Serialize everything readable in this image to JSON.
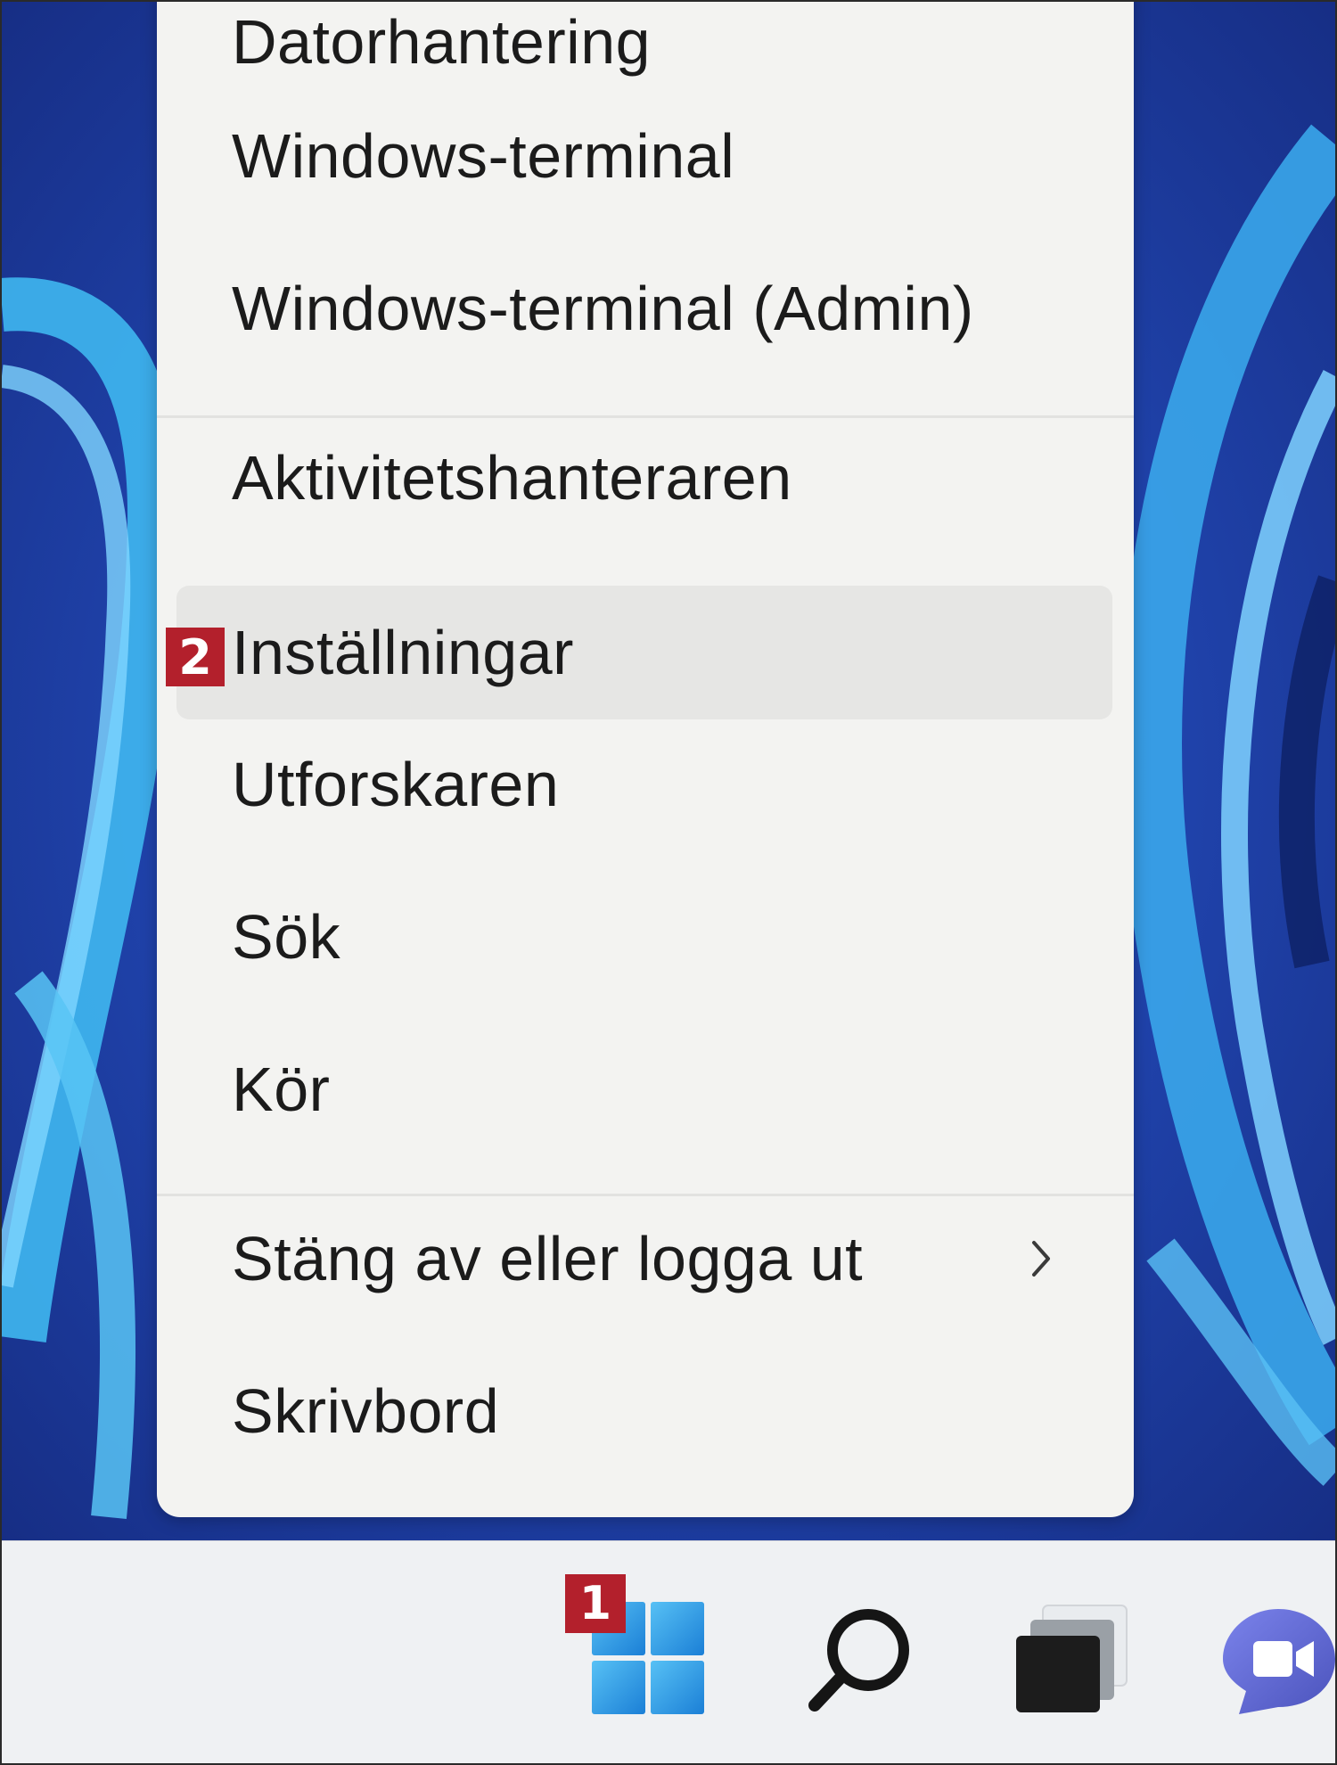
{
  "context_menu": {
    "items": [
      {
        "label": "Datorhantering"
      },
      {
        "label": "Windows-terminal"
      },
      {
        "label": "Windows-terminal (Admin)"
      },
      {
        "label": "Aktivitetshanteraren"
      },
      {
        "label": "Inställningar"
      },
      {
        "label": "Utforskaren"
      },
      {
        "label": "Sök"
      },
      {
        "label": "Kör"
      },
      {
        "label": "Stäng av eller logga ut"
      },
      {
        "label": "Skrivbord"
      }
    ]
  },
  "annotations": {
    "start_marker": "1",
    "settings_marker": "2"
  },
  "taskbar": {
    "icons": [
      "windows-start-icon",
      "search-icon",
      "task-view-icon",
      "teams-chat-icon"
    ]
  },
  "colors": {
    "marker": "#b3202c",
    "menu_background": "#f3f3f1",
    "hover_highlight": "#e6e6e4",
    "taskbar_background": "#eff1f3"
  }
}
